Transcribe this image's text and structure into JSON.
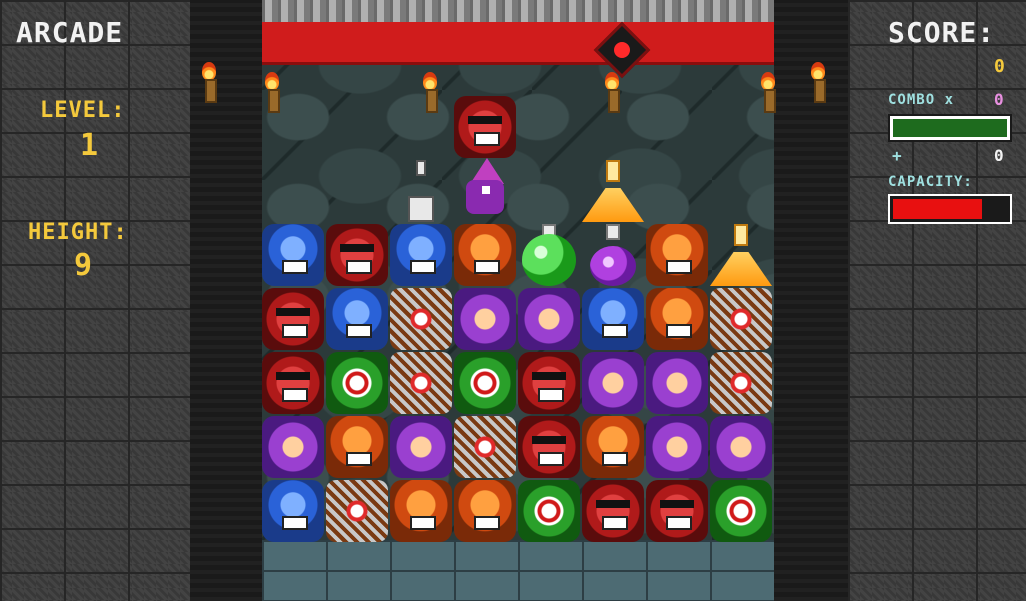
{
  "hud_left": {
    "mode": "ARCADE",
    "level_label": "LEVEL:",
    "level_value": "1",
    "height_label": "HEIGHT:",
    "height_value": "9"
  },
  "hud_right": {
    "score_label": "SCORE:",
    "score_value": "0",
    "combo_label": "COMBO x",
    "combo_value": "0",
    "combo_bar_fill": 1.0,
    "plus_label": "+",
    "plus_value": "0",
    "capacity_label": "CAPACITY:",
    "capacity_fill": 0.78
  },
  "colors": {
    "accent_yellow": "#f4c93c",
    "capacity_red": "#e81010",
    "combo_green": "#1e6b1e",
    "ceiling_red": "#d01c1c"
  },
  "board": {
    "held_item": "red-chomper",
    "player": "purple-wizard",
    "floating_items": [
      {
        "col": 2,
        "type": "white-bottle"
      },
      {
        "col": 5,
        "type": "orange-flask"
      }
    ],
    "rows": [
      [
        "blue-fang",
        "red-shades",
        "blue-fang",
        "red-chomper",
        "green-potion",
        "purple-potion",
        "red-chomper",
        "orange-flask"
      ],
      [
        "red-shades",
        "blue-fang",
        "box-eye",
        "purple-puff",
        "purple-puff",
        "blue-fang",
        "red-chomper",
        "box-eye"
      ],
      [
        "red-shades",
        "green-eye",
        "box-eye",
        "green-eye",
        "red-shades",
        "purple-puff",
        "purple-puff",
        "box-eye"
      ],
      [
        "purple-puff",
        "red-chomper",
        "purple-puff",
        "box-eye",
        "red-shades",
        "red-chomper",
        "purple-puff",
        "purple-puff"
      ],
      [
        "blue-fang",
        "box-eye",
        "red-chomper",
        "red-chomper",
        "green-eye",
        "red-shades",
        "red-shades",
        "green-eye"
      ]
    ]
  }
}
